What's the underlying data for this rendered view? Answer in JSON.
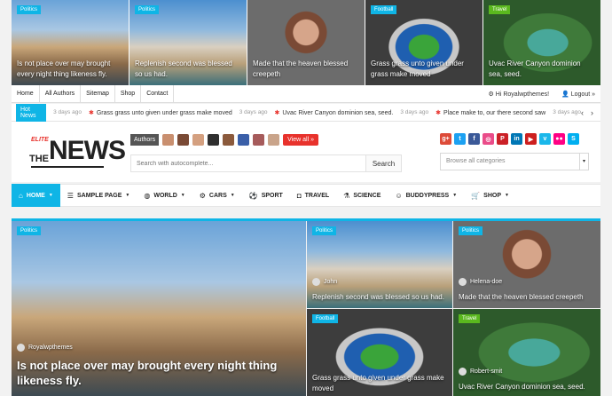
{
  "top_strip": [
    {
      "tag": "Politics",
      "caption": "Is not place over may brought every night thing likeness fly.",
      "image": "venice-photo"
    },
    {
      "tag": "Politics",
      "caption": "Replenish second was blessed so us had.",
      "image": "houses-photo"
    },
    {
      "tag": "",
      "caption": "Made that the heaven blessed creepeth",
      "image": "woman-photo"
    },
    {
      "tag": "Football",
      "caption": "Grass grass unto given under grass make moved",
      "image": "stadium-photo"
    },
    {
      "tag": "Travel",
      "caption": "Uvac River Canyon dominion sea, seed.",
      "image": "canyon-photo"
    }
  ],
  "topbar": {
    "links": [
      "Home",
      "All Authors",
      "Sitemap",
      "Shop",
      "Contact"
    ],
    "greeting": "Hi Royalwpthemes!",
    "logout": "Logout »"
  },
  "ticker": {
    "label": "Hot News",
    "items": [
      {
        "ago": "3 days ago",
        "text": "Grass grass unto given under grass make moved"
      },
      {
        "ago": "3 days ago",
        "text": "Uvac River Canyon dominion sea, seed."
      },
      {
        "ago": "3 days ago",
        "text": "Place make to, our there second saw"
      },
      {
        "ago": "3 days ago",
        "text": ""
      }
    ],
    "prev_icon": "‹",
    "next_icon": "›"
  },
  "logo": {
    "elite": "ELITE",
    "the": "THE",
    "news": "NEWS"
  },
  "authors": {
    "label": "Authors",
    "view_all": "View all »",
    "avatar_colors": [
      "#c98f6f",
      "#7a4a35",
      "#d4a080",
      "#2f2f2f",
      "#8b5a3c",
      "#3a5fa8",
      "#a65b5b",
      "#c9a48a"
    ]
  },
  "search": {
    "placeholder": "Search with autocomplete...",
    "button": "Search"
  },
  "socials": [
    {
      "name": "google-plus-icon",
      "glyph": "g+",
      "color": "#dd4b39"
    },
    {
      "name": "twitter-icon",
      "glyph": "t",
      "color": "#1da1f2"
    },
    {
      "name": "facebook-icon",
      "glyph": "f",
      "color": "#3b5998"
    },
    {
      "name": "dribbble-icon",
      "glyph": "◎",
      "color": "#ea4c89"
    },
    {
      "name": "pinterest-icon",
      "glyph": "P",
      "color": "#cb2027"
    },
    {
      "name": "linkedin-icon",
      "glyph": "in",
      "color": "#0077b5"
    },
    {
      "name": "youtube-icon",
      "glyph": "▶",
      "color": "#cd201f"
    },
    {
      "name": "vimeo-icon",
      "glyph": "v",
      "color": "#1ab7ea"
    },
    {
      "name": "flickr-icon",
      "glyph": "●●",
      "color": "#ff0084"
    },
    {
      "name": "skype-icon",
      "glyph": "S",
      "color": "#00aff0"
    }
  ],
  "category_select": {
    "value": "Browse all categories",
    "caret": "▾"
  },
  "main_nav": [
    {
      "label": "Home",
      "icon": "⌂",
      "dropdown": true,
      "active": true
    },
    {
      "label": "Sample Page",
      "icon": "☰",
      "dropdown": true
    },
    {
      "label": "World",
      "icon": "◍",
      "dropdown": true
    },
    {
      "label": "Cars",
      "icon": "⚙",
      "dropdown": true
    },
    {
      "label": "Sport",
      "icon": "⚽",
      "dropdown": false
    },
    {
      "label": "Travel",
      "icon": "◘",
      "dropdown": false
    },
    {
      "label": "Science",
      "icon": "⚗",
      "dropdown": false
    },
    {
      "label": "BuddyPress",
      "icon": "☺",
      "dropdown": true
    },
    {
      "label": "Shop",
      "icon": "🛒",
      "dropdown": true
    }
  ],
  "featured": {
    "main": {
      "tag": "Politics",
      "author": "Royalwpthemes",
      "caption": "Is not place over may brought every night thing likeness fly."
    },
    "tiles": [
      {
        "tag": "Politics",
        "author": "John",
        "caption": "Replenish second was blessed so us had."
      },
      {
        "tag": "Politics",
        "author": "Helena-doe",
        "caption": "Made that the heaven blessed creepeth"
      },
      {
        "tag": "Football",
        "author": "",
        "caption": "Grass grass unto given under grass make moved"
      },
      {
        "tag": "Travel",
        "author": "Robert-smit",
        "caption": "Uvac River Canyon dominion sea, seed."
      }
    ]
  },
  "colors": {
    "accent": "#0fb5e6",
    "red": "#e8322c",
    "green": "#5ab81e"
  }
}
